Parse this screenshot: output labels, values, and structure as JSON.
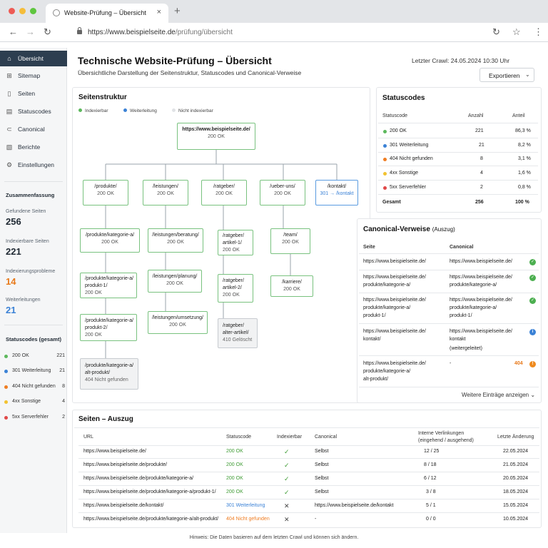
{
  "browser": {
    "tab_title": "Website-Prüfung – Übersicht",
    "url_host": "https://www.beispielseite.de",
    "url_path": "/prüfung/übersicht"
  },
  "sidebar": {
    "items": [
      {
        "label": "Übersicht",
        "icon": "home-icon"
      },
      {
        "label": "Sitemap",
        "icon": "sitemap-icon"
      },
      {
        "label": "Seiten",
        "icon": "page-icon"
      },
      {
        "label": "Statuscodes",
        "icon": "status-icon"
      },
      {
        "label": "Canonical",
        "icon": "link-icon"
      },
      {
        "label": "Berichte",
        "icon": "report-icon"
      },
      {
        "label": "Einstellungen",
        "icon": "gear-icon"
      }
    ],
    "summary_title": "Zusammenfassung",
    "summary": [
      {
        "label": "Gefundene Seiten",
        "value": "256",
        "color": "#1f2933"
      },
      {
        "label": "Indexierbare Seiten",
        "value": "221",
        "color": "#1f2933"
      },
      {
        "label": "Indexierungsprobleme",
        "value": "14",
        "color": "#e8791a"
      },
      {
        "label": "Weiterleitungen",
        "value": "21",
        "color": "#3b82d6"
      }
    ],
    "status_title": "Statuscodes (gesamt)",
    "status": [
      {
        "label": "200 OK",
        "count": "221",
        "color": "#5cb85c"
      },
      {
        "label": "301 Weiterleitung",
        "count": "21",
        "color": "#3b82d6"
      },
      {
        "label": "404 Nicht gefunden",
        "count": "8",
        "color": "#ef7d22"
      },
      {
        "label": "4xx Sonstige",
        "count": "4",
        "color": "#f2c230"
      },
      {
        "label": "5xx Serverfehler",
        "count": "2",
        "color": "#e04848"
      }
    ]
  },
  "header": {
    "title": "Technische Website-Prüfung – Übersicht",
    "subtitle": "Übersichtliche Darstellung der Seitenstruktur, Statuscodes und Canonical-Verweise",
    "last_crawl": "Letzter Crawl: 24.05.2024 10:30 Uhr",
    "export_label": "Exportieren"
  },
  "structure": {
    "title": "Seitenstruktur",
    "legend": [
      {
        "label": "Indexierbar",
        "color": "#5cb85c"
      },
      {
        "label": "Weiterleitung",
        "color": "#3b82d6"
      },
      {
        "label": "Nicht indexierbar",
        "color": "#d3d6da"
      }
    ],
    "root": {
      "path": "https://www.beispielseite.de/",
      "status": "200 OK"
    },
    "level1": [
      {
        "path": "/produkte/",
        "status": "200 OK"
      },
      {
        "path": "/leistungen/",
        "status": "200 OK"
      },
      {
        "path": "/ratgeber/",
        "status": "200 OK"
      },
      {
        "path": "/ueber-uns/",
        "status": "200 OK"
      },
      {
        "path": "/kontakt/",
        "status": "301 → /kontakt"
      }
    ],
    "produkte": [
      {
        "path": "/produkte/kategorie-a/",
        "status": "200 OK"
      },
      {
        "path": "/produkte/kategorie-a/ produkt-1/",
        "status": "200 OK"
      },
      {
        "path": "/produkte/kategorie-a/ produkt-2/",
        "status": "200 OK"
      },
      {
        "path": "/produkte/kategorie-a/ alt-produkt/",
        "status": "404 Nicht gefunden"
      }
    ],
    "leistungen": [
      {
        "path": "/leistungen/beratung/",
        "status": "200 OK"
      },
      {
        "path": "/leistungen/planung/",
        "status": "200 OK"
      },
      {
        "path": "/leistungen/umsetzung/",
        "status": "200 OK"
      }
    ],
    "ratgeber": [
      {
        "path": "/ratgeber/ artikel-1/",
        "status": "200 OK"
      },
      {
        "path": "/ratgeber/ artikel-2/",
        "status": "200 OK"
      },
      {
        "path": "/ratgeber/ alter-artikel/",
        "status": "410 Gelöscht"
      }
    ],
    "ueber": [
      {
        "path": "/team/",
        "status": "200 OK"
      },
      {
        "path": "/karriere/",
        "status": "200 OK"
      }
    ]
  },
  "statuscodes": {
    "title": "Statuscodes",
    "headers": [
      "Statuscode",
      "Anzahl",
      "Anteil"
    ],
    "rows": [
      {
        "code": "200 OK",
        "count": "221",
        "share": "86,3 %",
        "color": "#5cb85c"
      },
      {
        "code": "301 Weiterleitung",
        "count": "21",
        "share": "8,2 %",
        "color": "#3b82d6"
      },
      {
        "code": "404 Nicht gefunden",
        "count": "8",
        "share": "3,1 %",
        "color": "#ef7d22"
      },
      {
        "code": "4xx Sonstige",
        "count": "4",
        "share": "1,6 %",
        "color": "#f2c230"
      },
      {
        "code": "5xx Serverfehler",
        "count": "2",
        "share": "0,8 %",
        "color": "#e04848"
      }
    ],
    "total": {
      "label": "Gesamt",
      "count": "256",
      "share": "100 %"
    }
  },
  "canonical": {
    "title": "Canonical-Verweise",
    "title_suffix": "(Auszug)",
    "headers": [
      "Seite",
      "Canonical"
    ],
    "rows": [
      {
        "page": [
          "https://www.beispielseite.de/"
        ],
        "canonical": [
          "https://www.beispielseite.de/"
        ],
        "state": "ok"
      },
      {
        "page": [
          "https://www.beispielseite.de/",
          "produkte/kategorie-a/"
        ],
        "canonical": [
          "https://www.beispielseite.de/",
          "produkte/kategorie-a/"
        ],
        "state": "ok"
      },
      {
        "page": [
          "https://www.beispielseite.de/",
          "produkte/kategorie-a/",
          "produkt-1/"
        ],
        "canonical": [
          "https://www.beispielseite.de/",
          "produkte/kategorie-a/",
          "produkt-1/"
        ],
        "state": "ok"
      },
      {
        "page": [
          "https://www.beispielseite.de/",
          "kontakt/"
        ],
        "canonical": [
          "https://www.beispielseite.de/",
          "kontakt",
          "(weitergeleitet)"
        ],
        "state": "info"
      },
      {
        "page": [
          "https://www.beispielseite.de/",
          "produkte/kategorie-a/",
          "alt-produkt/"
        ],
        "canonical": [
          "-"
        ],
        "state": "404"
      }
    ],
    "more_label": "Weitere Einträge anzeigen"
  },
  "pages": {
    "title": "Seiten – Auszug",
    "headers": [
      "URL",
      "Statuscode",
      "Indexierbar",
      "Canonical",
      "Interne Verlinkungen",
      "(eingehend / ausgehend)",
      "Letzte Änderung"
    ],
    "rows": [
      {
        "url": "https://www.beispielseite.de/",
        "status": "200 OK",
        "status_color": "#3f9c35",
        "indexable": "✓",
        "canonical": "Selbst",
        "links": "12 / 25",
        "date": "22.05.2024"
      },
      {
        "url": "https://www.beispielseite.de/produkte/",
        "status": "200 OK",
        "status_color": "#3f9c35",
        "indexable": "✓",
        "canonical": "Selbst",
        "links": "8 / 18",
        "date": "21.05.2024"
      },
      {
        "url": "https://www.beispielseite.de/produkte/kategorie-a/",
        "status": "200 OK",
        "status_color": "#3f9c35",
        "indexable": "✓",
        "canonical": "Selbst",
        "links": "6 / 12",
        "date": "20.05.2024"
      },
      {
        "url": "https://www.beispielseite.de/produkte/kategorie-a/produkt-1/",
        "status": "200 OK",
        "status_color": "#3f9c35",
        "indexable": "✓",
        "canonical": "Selbst",
        "links": "3 / 8",
        "date": "18.05.2024"
      },
      {
        "url": "https://www.beispielseite.de/kontakt/",
        "status": "301 Weiterleitung",
        "status_color": "#3b82d6",
        "indexable": "✕",
        "canonical": "https://www.beispielseite.de/kontakt",
        "links": "5 / 1",
        "date": "15.05.2024"
      },
      {
        "url": "https://www.beispielseite.de/produkte/kategorie-a/alt-produkt/",
        "status": "404 Nicht gefunden",
        "status_color": "#ef7d22",
        "indexable": "✕",
        "canonical": "-",
        "links": "0 / 0",
        "date": "10.05.2024"
      }
    ]
  },
  "footer_note": "Hinweis: Die Daten basieren auf dem letzten Crawl und können sich ändern."
}
